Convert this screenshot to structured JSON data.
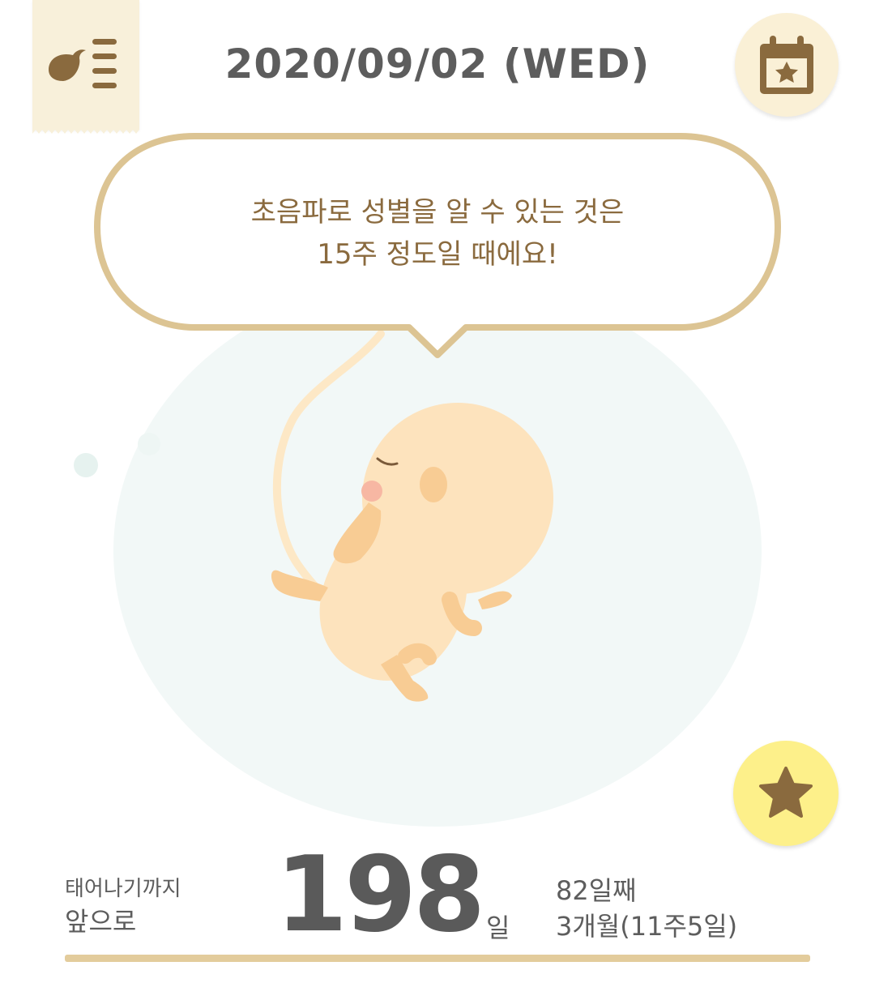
{
  "header": {
    "date": "2020/09/02 (WED)"
  },
  "bubble": {
    "line1": "초음파로 성별을 알 수 있는 것은",
    "line2": "15주 정도일 때에요!"
  },
  "countdown": {
    "label_top": "태어나기까지",
    "label_bottom": "앞으로",
    "days": "198",
    "unit": "일"
  },
  "progress": {
    "day_count": "82일째",
    "detail": "3개월(11주5일)"
  },
  "colors": {
    "brown": "#8a6a3e",
    "gold": "#dcc493",
    "cream": "#faf0d6",
    "yellow": "#fdf08a",
    "text": "#5d5d5d"
  },
  "icons": {
    "menu": "bird-menu-icon",
    "calendar": "calendar-star-icon",
    "favorite": "star-icon"
  }
}
